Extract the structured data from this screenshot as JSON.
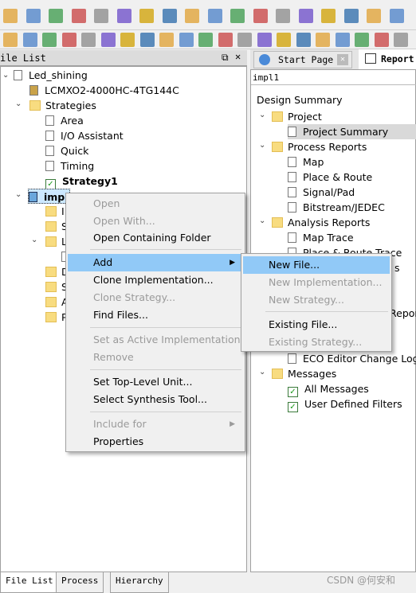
{
  "toolbar": {
    "row1_icons": [
      "new-file-icon",
      "open-folder-icon",
      "save-icon",
      "save-all-icon",
      "print-icon",
      "undo-icon",
      "redo-icon",
      "cut-icon",
      "copy-icon",
      "paste-icon",
      "start-page-icon",
      "report-icon",
      "spreadsheet-icon",
      "zoom-in-icon",
      "zoom-out-icon",
      "zoom-fit-icon",
      "find-icon",
      "checklist-icon"
    ],
    "row2_icons": [
      "edit-icon",
      "layout-icon",
      "chip-icon",
      "netlist-icon",
      "hierarchy-icon",
      "device-icon",
      "floorplan-icon",
      "waveform-download-icon",
      "waveform-icon",
      "package-icon",
      "grid-icon",
      "timing-icon",
      "power-calc-icon",
      "memory-icon",
      "programmer-icon",
      "synplify-icon",
      "reveal-icon",
      "sync-icon",
      "active-hdl-icon",
      "settings-icon",
      "tools-icon"
    ]
  },
  "left": {
    "title": "ile List",
    "tree": [
      {
        "label": "Led_shining",
        "icon": "project-icon"
      },
      {
        "label": "LCMXO2-4000HC-4TG144C",
        "icon": "device-icon"
      },
      {
        "label": "Strategies",
        "icon": "folder-icon"
      },
      {
        "label": "Area",
        "icon": "file-icon"
      },
      {
        "label": "I/O Assistant",
        "icon": "file-icon"
      },
      {
        "label": "Quick",
        "icon": "file-icon"
      },
      {
        "label": "Timing",
        "icon": "file-icon"
      },
      {
        "label": "Strategy1",
        "icon": "checklist-icon"
      },
      {
        "label": "imp",
        "icon": "implementation-icon"
      }
    ],
    "sub": [
      "I",
      "S",
      "L",
      "",
      "D",
      "S",
      "A",
      "P"
    ],
    "tabs": [
      "File List",
      "Process",
      "Hierarchy"
    ]
  },
  "right": {
    "tabs": [
      "Start Page",
      "Report"
    ],
    "subtitle": "impl1",
    "tree": [
      "Design Summary",
      "Project",
      "Project Summary",
      "Process Reports",
      "Map",
      "Place & Route",
      "Signal/Pad",
      "Bitstream/JEDEC",
      "Analysis Reports",
      "Map Trace",
      "Place & Route Trace",
      "s",
      "Repor",
      "ECO Editor Change Log",
      "Messages",
      "All Messages",
      "User Defined Filters"
    ]
  },
  "context_menu": {
    "items": [
      "Open",
      "Open With...",
      "Open Containing Folder",
      "Add",
      "Clone Implementation...",
      "Clone Strategy...",
      "Find Files...",
      "Set as Active Implementation",
      "Remove",
      "Set Top-Level Unit...",
      "Select Synthesis Tool...",
      "Include for",
      "Properties"
    ]
  },
  "submenu": {
    "items": [
      "New File...",
      "New Implementation...",
      "New Strategy...",
      "Existing File...",
      "Existing Strategy..."
    ]
  },
  "watermark": "CSDN @何安和"
}
